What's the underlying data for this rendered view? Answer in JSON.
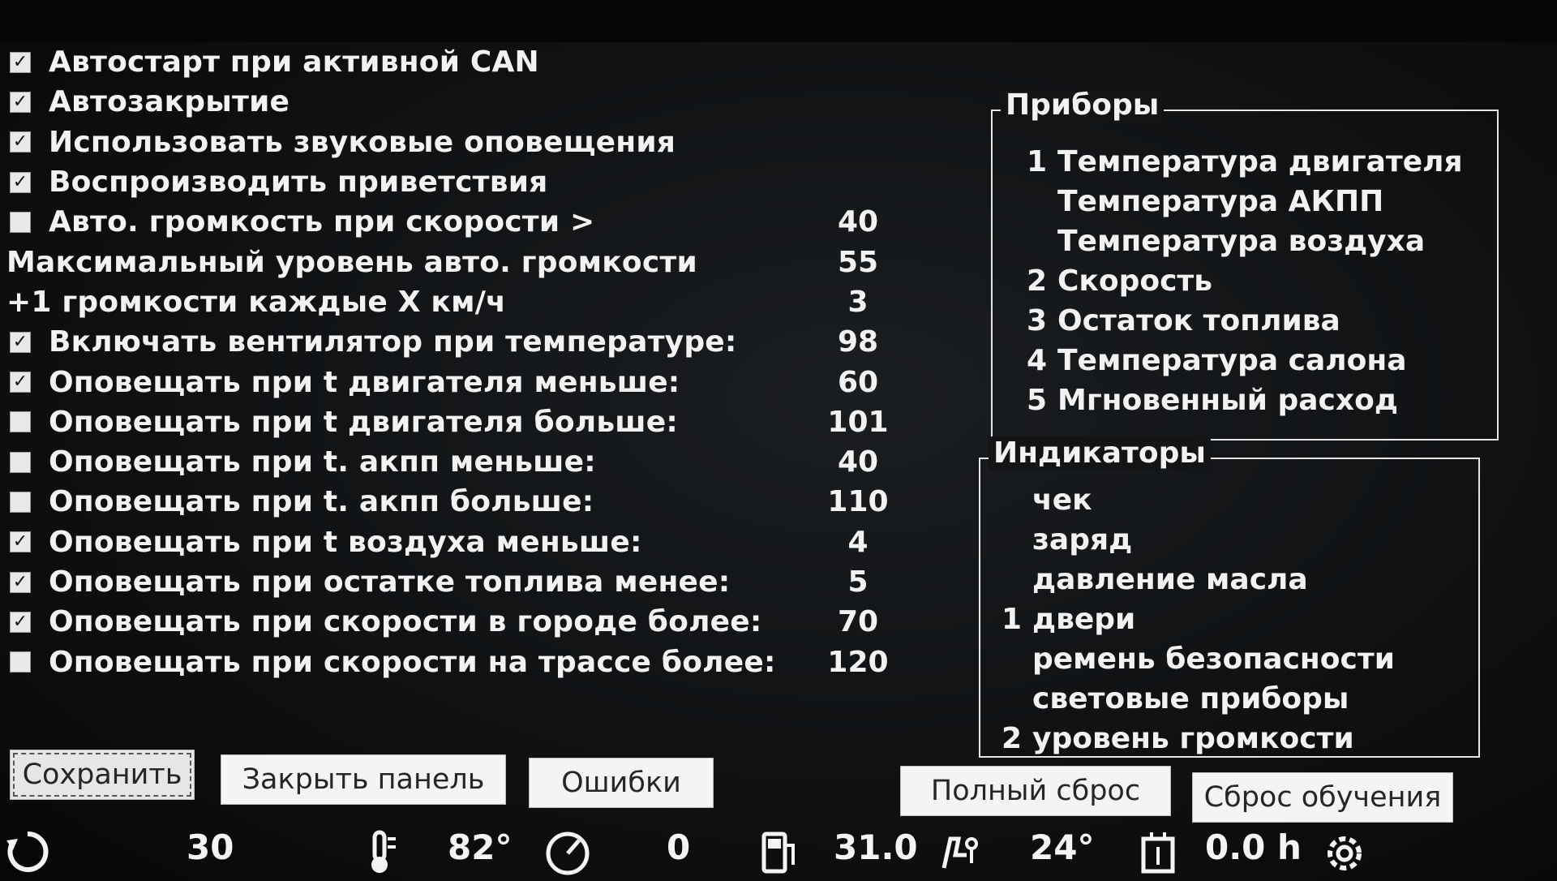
{
  "settings": [
    {
      "type": "checkbox",
      "checked": true,
      "label": "Автостарт при активной CAN",
      "value": ""
    },
    {
      "type": "checkbox",
      "checked": true,
      "label": "Автозакрытие",
      "value": ""
    },
    {
      "type": "checkbox",
      "checked": true,
      "label": "Использовать звуковые оповещения",
      "value": ""
    },
    {
      "type": "checkbox",
      "checked": true,
      "label": "Воспроизводить приветствия",
      "value": ""
    },
    {
      "type": "checkbox",
      "checked": false,
      "label": "Авто. громкость при скорости >",
      "value": "40"
    },
    {
      "type": "text",
      "checked": false,
      "label": "Максимальный уровень авто. громкости",
      "value": "55"
    },
    {
      "type": "text",
      "checked": false,
      "label": "+1 громкости каждые X км/ч",
      "value": "3"
    },
    {
      "type": "checkbox",
      "checked": true,
      "label": "Включать вентилятор при температуре:",
      "value": "98"
    },
    {
      "type": "checkbox",
      "checked": true,
      "label": "Оповещать при t двигателя меньше:",
      "value": "60"
    },
    {
      "type": "checkbox",
      "checked": false,
      "label": "Оповещать при t двигателя больше:",
      "value": "101"
    },
    {
      "type": "checkbox",
      "checked": false,
      "label": "Оповещать при t. акпп меньше:",
      "value": "40"
    },
    {
      "type": "checkbox",
      "checked": false,
      "label": "Оповещать при t. акпп больше:",
      "value": "110"
    },
    {
      "type": "checkbox",
      "checked": true,
      "label": "Оповещать при t воздуха меньше:",
      "value": "4"
    },
    {
      "type": "checkbox",
      "checked": true,
      "label": "Оповещать при остатке топлива менее:",
      "value": "5"
    },
    {
      "type": "checkbox",
      "checked": true,
      "label": "Оповещать при скорости в городе более:",
      "value": "70"
    },
    {
      "type": "checkbox",
      "checked": false,
      "label": "Оповещать при скорости на трассе более:",
      "value": "120"
    }
  ],
  "devices": {
    "title": "Приборы",
    "items": [
      {
        "num": "1",
        "label": "Температура двигателя"
      },
      {
        "num": "",
        "label": "Температура АКПП"
      },
      {
        "num": "",
        "label": "Температура воздуха"
      },
      {
        "num": "2",
        "label": "Скорость"
      },
      {
        "num": "3",
        "label": "Остаток топлива"
      },
      {
        "num": "4",
        "label": "Температура салона"
      },
      {
        "num": "5",
        "label": "Мгновенный расход"
      }
    ]
  },
  "indicators": {
    "title": "Индикаторы",
    "items": [
      {
        "num": "",
        "label": "чек"
      },
      {
        "num": "",
        "label": "заряд"
      },
      {
        "num": "",
        "label": "давление масла"
      },
      {
        "num": "1",
        "label": "двери"
      },
      {
        "num": "",
        "label": "ремень безопасности"
      },
      {
        "num": "",
        "label": "световые приборы"
      },
      {
        "num": "2",
        "label": "уровень громкости"
      }
    ]
  },
  "buttons": {
    "save": "Сохранить",
    "close_panel": "Закрыть панель",
    "errors": "Ошибки",
    "full_reset": "Полный сброс",
    "reset_learning": "Сброс обучения"
  },
  "status": {
    "refresh_icon": "refresh-icon",
    "volume": "30",
    "engine_temp": "82°",
    "speed": "0",
    "fuel": "31.0",
    "cabin_temp": "24°",
    "engine_hours": "0.0 h",
    "settings_icon": "gear-icon"
  },
  "colors": {
    "background": "#121416",
    "text": "#f2f2f2",
    "button": "#f4f4f4",
    "panel_border": "#e6e6e6"
  }
}
